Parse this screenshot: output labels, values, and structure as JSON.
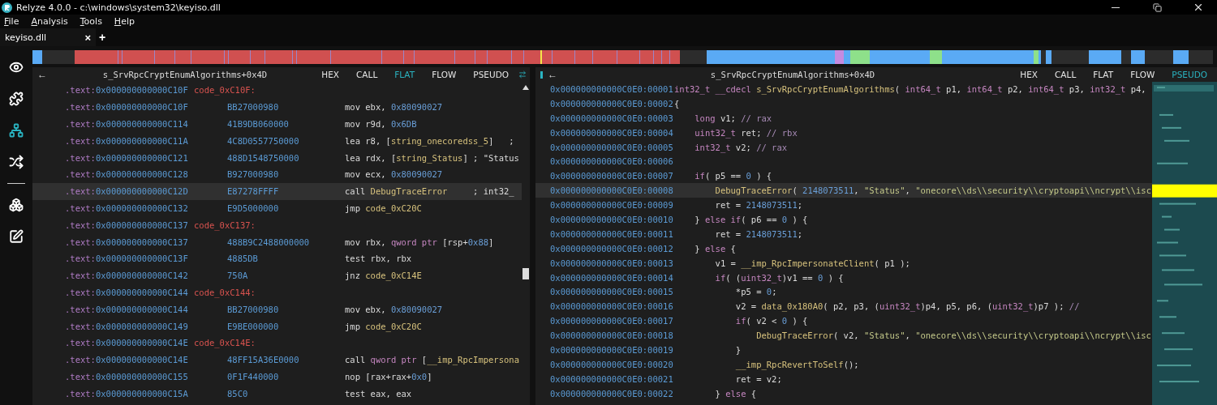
{
  "window": {
    "title": "Relyze 4.0.0 - c:\\windows\\system32\\keyiso.dll"
  },
  "menu": [
    {
      "label": "File"
    },
    {
      "label": "Analysis"
    },
    {
      "label": "Tools"
    },
    {
      "label": "Help"
    }
  ],
  "tabs": [
    {
      "label": "keyiso.dll",
      "selected": true,
      "close": "×"
    }
  ],
  "new_tab": "+",
  "sidebar": [
    {
      "selected": false
    },
    {
      "selected": false
    },
    {
      "selected": true
    },
    {
      "selected": false
    },
    {
      "selected": false
    },
    {
      "selected": false
    }
  ],
  "left_pane": {
    "back": "←",
    "title": "s_SrvRpcCryptEnumAlgorithms+0x4D",
    "views": [
      {
        "label": "HEX",
        "selected": false
      },
      {
        "label": "CALL",
        "selected": false
      },
      {
        "label": "FLAT",
        "selected": true
      },
      {
        "label": "FLOW",
        "selected": false
      },
      {
        "label": "PSEUDO",
        "selected": false
      }
    ],
    "rows": [
      {
        "kind": "label",
        "segment": ".text:",
        "address": "0x000000000000C10F",
        "label": "code_0xC10F:",
        "selected": false
      },
      {
        "kind": "instruction",
        "segment": ".text:",
        "address": "0x000000000000C10F",
        "bytes": "BB27000980",
        "code": [
          {
            "kind": "plain",
            "text": "mov ebx, "
          },
          {
            "kind": "number",
            "text": "0x80090027"
          }
        ],
        "selected": false
      },
      {
        "kind": "instruction",
        "segment": ".text:",
        "address": "0x000000000000C114",
        "bytes": "41B9DB060000",
        "code": [
          {
            "kind": "plain",
            "text": "mov r9d, "
          },
          {
            "kind": "number",
            "text": "0x6DB"
          }
        ],
        "selected": false
      },
      {
        "kind": "instruction",
        "segment": ".text:",
        "address": "0x000000000000C11A",
        "bytes": "4C8D0557750000",
        "code": [
          {
            "kind": "plain",
            "text": "lea r8, ["
          },
          {
            "kind": "function",
            "text": "string_onecoredss_5"
          },
          {
            "kind": "plain",
            "text": "]   ;"
          }
        ],
        "selected": false
      },
      {
        "kind": "instruction",
        "segment": ".text:",
        "address": "0x000000000000C121",
        "bytes": "488D1548750000",
        "code": [
          {
            "kind": "plain",
            "text": "lea rdx, ["
          },
          {
            "kind": "function",
            "text": "string_Status"
          },
          {
            "kind": "plain",
            "text": "] ; \"Status"
          }
        ],
        "selected": false
      },
      {
        "kind": "instruction",
        "segment": ".text:",
        "address": "0x000000000000C128",
        "bytes": "B927000980",
        "code": [
          {
            "kind": "plain",
            "text": "mov ecx, "
          },
          {
            "kind": "number",
            "text": "0x80090027"
          }
        ],
        "selected": false
      },
      {
        "kind": "instruction",
        "segment": ".text:",
        "address": "0x000000000000C12D",
        "bytes": "E87278FFFF",
        "code": [
          {
            "kind": "plain",
            "text": "call "
          },
          {
            "kind": "function",
            "text": "DebugTraceError"
          },
          {
            "kind": "plain",
            "text": "     ; int32_"
          }
        ],
        "selected": true
      },
      {
        "kind": "instruction",
        "segment": ".text:",
        "address": "0x000000000000C132",
        "bytes": "E9D5000000",
        "code": [
          {
            "kind": "plain",
            "text": "jmp "
          },
          {
            "kind": "function",
            "text": "code_0xC20C"
          }
        ],
        "selected": false
      },
      {
        "kind": "label",
        "segment": ".text:",
        "address": "0x000000000000C137",
        "label": "code_0xC137:",
        "selected": false
      },
      {
        "kind": "instruction",
        "segment": ".text:",
        "address": "0x000000000000C137",
        "bytes": "488B9C2488000000",
        "code": [
          {
            "kind": "plain",
            "text": "mov rbx, "
          },
          {
            "kind": "keyword",
            "text": "qword ptr"
          },
          {
            "kind": "plain",
            "text": " [rsp+"
          },
          {
            "kind": "number",
            "text": "0x88"
          },
          {
            "kind": "plain",
            "text": "]"
          }
        ],
        "selected": false
      },
      {
        "kind": "instruction",
        "segment": ".text:",
        "address": "0x000000000000C13F",
        "bytes": "4885DB",
        "code": [
          {
            "kind": "plain",
            "text": "test rbx, rbx"
          }
        ],
        "selected": false
      },
      {
        "kind": "instruction",
        "segment": ".text:",
        "address": "0x000000000000C142",
        "bytes": "750A",
        "code": [
          {
            "kind": "plain",
            "text": "jnz "
          },
          {
            "kind": "function",
            "text": "code_0xC14E"
          }
        ],
        "selected": false
      },
      {
        "kind": "label",
        "segment": ".text:",
        "address": "0x000000000000C144",
        "label": "code_0xC144:",
        "selected": false
      },
      {
        "kind": "instruction",
        "segment": ".text:",
        "address": "0x000000000000C144",
        "bytes": "BB27000980",
        "code": [
          {
            "kind": "plain",
            "text": "mov ebx, "
          },
          {
            "kind": "number",
            "text": "0x80090027"
          }
        ],
        "selected": false
      },
      {
        "kind": "instruction",
        "segment": ".text:",
        "address": "0x000000000000C149",
        "bytes": "E9BE000000",
        "code": [
          {
            "kind": "plain",
            "text": "jmp "
          },
          {
            "kind": "function",
            "text": "code_0xC20C"
          }
        ],
        "selected": false
      },
      {
        "kind": "label",
        "segment": ".text:",
        "address": "0x000000000000C14E",
        "label": "code_0xC14E:",
        "selected": false
      },
      {
        "kind": "instruction",
        "segment": ".text:",
        "address": "0x000000000000C14E",
        "bytes": "48FF15A36E0000",
        "code": [
          {
            "kind": "plain",
            "text": "call "
          },
          {
            "kind": "keyword",
            "text": "qword ptr"
          },
          {
            "kind": "plain",
            "text": " ["
          },
          {
            "kind": "function",
            "text": "__imp_RpcImpersona"
          }
        ],
        "selected": false
      },
      {
        "kind": "instruction",
        "segment": ".text:",
        "address": "0x000000000000C155",
        "bytes": "0F1F440000",
        "code": [
          {
            "kind": "plain",
            "text": "nop [rax+rax+"
          },
          {
            "kind": "number",
            "text": "0x0"
          },
          {
            "kind": "plain",
            "text": "]"
          }
        ],
        "selected": false
      },
      {
        "kind": "instruction",
        "segment": ".text:",
        "address": "0x000000000000C15A",
        "bytes": "85C0",
        "code": [
          {
            "kind": "plain",
            "text": "test eax, eax"
          }
        ],
        "selected": false
      }
    ]
  },
  "right_pane": {
    "back": "←",
    "title": "s_SrvRpcCryptEnumAlgorithms+0x4D",
    "views": [
      {
        "label": "HEX",
        "selected": false
      },
      {
        "label": "CALL",
        "selected": false
      },
      {
        "label": "FLAT",
        "selected": false
      },
      {
        "label": "FLOW",
        "selected": false
      },
      {
        "label": "PSEUDO",
        "selected": true
      }
    ],
    "lines": [
      {
        "number": "0x000000000000C0E0:00001",
        "selected": false,
        "code": [
          {
            "kind": "keyword",
            "text": "int32_t "
          },
          {
            "kind": "keyword",
            "text": "__cdecl "
          },
          {
            "kind": "function",
            "text": "s_SrvRpcCryptEnumAlgorithms"
          },
          {
            "kind": "plain",
            "text": "( "
          },
          {
            "kind": "keyword",
            "text": "int64_t"
          },
          {
            "kind": "plain",
            "text": " p1, "
          },
          {
            "kind": "keyword",
            "text": "int64_t"
          },
          {
            "kind": "plain",
            "text": " p2, "
          },
          {
            "kind": "keyword",
            "text": "int64_t"
          },
          {
            "kind": "plain",
            "text": " p3, "
          },
          {
            "kind": "keyword",
            "text": "int32_t"
          },
          {
            "kind": "plain",
            "text": " p4,"
          }
        ]
      },
      {
        "number": "0x000000000000C0E0:00002",
        "selected": false,
        "code": [
          {
            "kind": "plain",
            "text": "{"
          }
        ]
      },
      {
        "number": "0x000000000000C0E0:00003",
        "selected": false,
        "code": [
          {
            "kind": "keyword",
            "text": "    long"
          },
          {
            "kind": "plain",
            "text": " v1; "
          },
          {
            "kind": "comment",
            "text": "// rax"
          }
        ]
      },
      {
        "number": "0x000000000000C0E0:00004",
        "selected": false,
        "code": [
          {
            "kind": "keyword",
            "text": "    uint32_t"
          },
          {
            "kind": "plain",
            "text": " ret; "
          },
          {
            "kind": "comment",
            "text": "// rbx"
          }
        ]
      },
      {
        "number": "0x000000000000C0E0:00005",
        "selected": false,
        "code": [
          {
            "kind": "keyword",
            "text": "    int32_t"
          },
          {
            "kind": "plain",
            "text": " v2; "
          },
          {
            "kind": "comment",
            "text": "// rax"
          }
        ]
      },
      {
        "number": "0x000000000000C0E0:00006",
        "selected": false
      },
      {
        "number": "0x000000000000C0E0:00007",
        "selected": false,
        "code": [
          {
            "kind": "keyword",
            "text": "    if"
          },
          {
            "kind": "plain",
            "text": "( p5 == "
          },
          {
            "kind": "number",
            "text": "0"
          },
          {
            "kind": "plain",
            "text": " ) {"
          }
        ]
      },
      {
        "number": "0x000000000000C0E0:00008",
        "selected": true,
        "code": [
          {
            "kind": "function",
            "text": "        DebugTraceError"
          },
          {
            "kind": "plain",
            "text": "( "
          },
          {
            "kind": "number",
            "text": "2148073511"
          },
          {
            "kind": "plain",
            "text": ", "
          },
          {
            "kind": "string",
            "text": "\"Status\""
          },
          {
            "kind": "plain",
            "text": ", "
          },
          {
            "kind": "string",
            "text": "\"onecore\\\\ds\\\\security\\\\cryptoapi\\\\ncrypt\\\\isc"
          }
        ]
      },
      {
        "number": "0x000000000000C0E0:00009",
        "selected": false,
        "code": [
          {
            "kind": "plain",
            "text": "        ret = "
          },
          {
            "kind": "number",
            "text": "2148073511"
          },
          {
            "kind": "plain",
            "text": ";"
          }
        ]
      },
      {
        "number": "0x000000000000C0E0:00010",
        "selected": false,
        "code": [
          {
            "kind": "plain",
            "text": "    } "
          },
          {
            "kind": "keyword",
            "text": "else if"
          },
          {
            "kind": "plain",
            "text": "( p6 == "
          },
          {
            "kind": "number",
            "text": "0"
          },
          {
            "kind": "plain",
            "text": " ) {"
          }
        ]
      },
      {
        "number": "0x000000000000C0E0:00011",
        "selected": false,
        "code": [
          {
            "kind": "plain",
            "text": "        ret = "
          },
          {
            "kind": "number",
            "text": "2148073511"
          },
          {
            "kind": "plain",
            "text": ";"
          }
        ]
      },
      {
        "number": "0x000000000000C0E0:00012",
        "selected": false,
        "code": [
          {
            "kind": "plain",
            "text": "    } "
          },
          {
            "kind": "keyword",
            "text": "else"
          },
          {
            "kind": "plain",
            "text": " {"
          }
        ]
      },
      {
        "number": "0x000000000000C0E0:00013",
        "selected": false,
        "code": [
          {
            "kind": "plain",
            "text": "        v1 = "
          },
          {
            "kind": "function",
            "text": "__imp_RpcImpersonateClient"
          },
          {
            "kind": "plain",
            "text": "( p1 );"
          }
        ]
      },
      {
        "number": "0x000000000000C0E0:00014",
        "selected": false,
        "code": [
          {
            "kind": "keyword",
            "text": "        if"
          },
          {
            "kind": "plain",
            "text": "( ("
          },
          {
            "kind": "keyword",
            "text": "uint32_t"
          },
          {
            "kind": "plain",
            "text": ")v1 == "
          },
          {
            "kind": "number",
            "text": "0"
          },
          {
            "kind": "plain",
            "text": " ) {"
          }
        ]
      },
      {
        "number": "0x000000000000C0E0:00015",
        "selected": false,
        "code": [
          {
            "kind": "plain",
            "text": "            *p5 = "
          },
          {
            "kind": "number",
            "text": "0"
          },
          {
            "kind": "plain",
            "text": ";"
          }
        ]
      },
      {
        "number": "0x000000000000C0E0:00016",
        "selected": false,
        "code": [
          {
            "kind": "plain",
            "text": "            v2 = "
          },
          {
            "kind": "function",
            "text": "data_0x180A0"
          },
          {
            "kind": "plain",
            "text": "( p2, p3, ("
          },
          {
            "kind": "keyword",
            "text": "uint32_t"
          },
          {
            "kind": "plain",
            "text": ")p4, p5, p6, ("
          },
          {
            "kind": "keyword",
            "text": "uint32_t"
          },
          {
            "kind": "plain",
            "text": ")p7 ); "
          },
          {
            "kind": "comment",
            "text": "//"
          }
        ]
      },
      {
        "number": "0x000000000000C0E0:00017",
        "selected": false,
        "code": [
          {
            "kind": "keyword",
            "text": "            if"
          },
          {
            "kind": "plain",
            "text": "( v2 < "
          },
          {
            "kind": "number",
            "text": "0"
          },
          {
            "kind": "plain",
            "text": " ) {"
          }
        ]
      },
      {
        "number": "0x000000000000C0E0:00018",
        "selected": false,
        "code": [
          {
            "kind": "function",
            "text": "                DebugTraceError"
          },
          {
            "kind": "plain",
            "text": "( v2, "
          },
          {
            "kind": "string",
            "text": "\"Status\""
          },
          {
            "kind": "plain",
            "text": ", "
          },
          {
            "kind": "string",
            "text": "\"onecore\\\\ds\\\\security\\\\cryptoapi\\\\ncrypt\\\\isc"
          }
        ]
      },
      {
        "number": "0x000000000000C0E0:00019",
        "selected": false,
        "code": [
          {
            "kind": "plain",
            "text": "            }"
          }
        ]
      },
      {
        "number": "0x000000000000C0E0:00020",
        "selected": false,
        "code": [
          {
            "kind": "function",
            "text": "            __imp_RpcRevertToSelf"
          },
          {
            "kind": "plain",
            "text": "();"
          }
        ]
      },
      {
        "number": "0x000000000000C0E0:00021",
        "selected": false,
        "code": [
          {
            "kind": "plain",
            "text": "            ret = v2;"
          }
        ]
      },
      {
        "number": "0x000000000000C0E0:00022",
        "selected": false,
        "code": [
          {
            "kind": "plain",
            "text": "        } "
          },
          {
            "kind": "keyword",
            "text": "else"
          },
          {
            "kind": "plain",
            "text": " {"
          }
        ]
      }
    ]
  }
}
